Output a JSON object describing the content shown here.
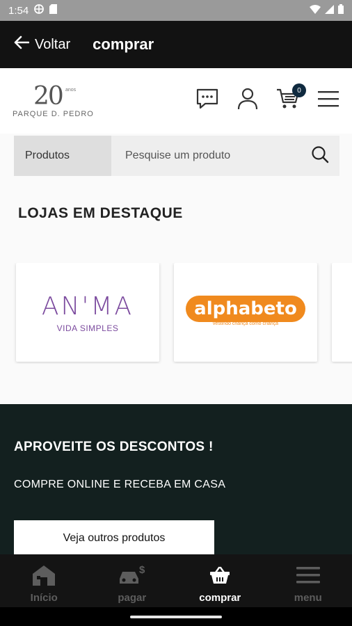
{
  "status_bar": {
    "time": "1:54"
  },
  "app_bar": {
    "back_label": "Voltar",
    "title": "comprar"
  },
  "header": {
    "logo": {
      "number": "20",
      "anos": "anos",
      "brand": "PARQUE D. PEDRO"
    },
    "cart_count": "0"
  },
  "search": {
    "category": "Produtos",
    "placeholder": "Pesquise um produto"
  },
  "featured": {
    "title": "LOJAS EM DESTAQUE",
    "stores": [
      {
        "name": "AN'MA",
        "subtitle": "VIDA SIMPLES",
        "color": "#7b4a9e"
      },
      {
        "name": "alphabeto",
        "tagline": "vestindo criança como criança",
        "color": "#f08a1e"
      }
    ]
  },
  "promo": {
    "title": "APROVEITE OS DESCONTOS !",
    "subtitle": "COMPRE ONLINE E RECEBA EM CASA",
    "button_label": "Veja outros produtos"
  },
  "bottom_nav": {
    "items": [
      {
        "label": "Início",
        "icon": "home-icon"
      },
      {
        "label": "pagar",
        "icon": "car-pay-icon"
      },
      {
        "label": "comprar",
        "icon": "basket-icon",
        "active": true
      },
      {
        "label": "menu",
        "icon": "menu-icon"
      }
    ]
  },
  "colors": {
    "app_bar": "#121212",
    "promo_bg": "#13201f",
    "badge": "#0f2a3f",
    "status_bar": "#9a9a9a"
  }
}
